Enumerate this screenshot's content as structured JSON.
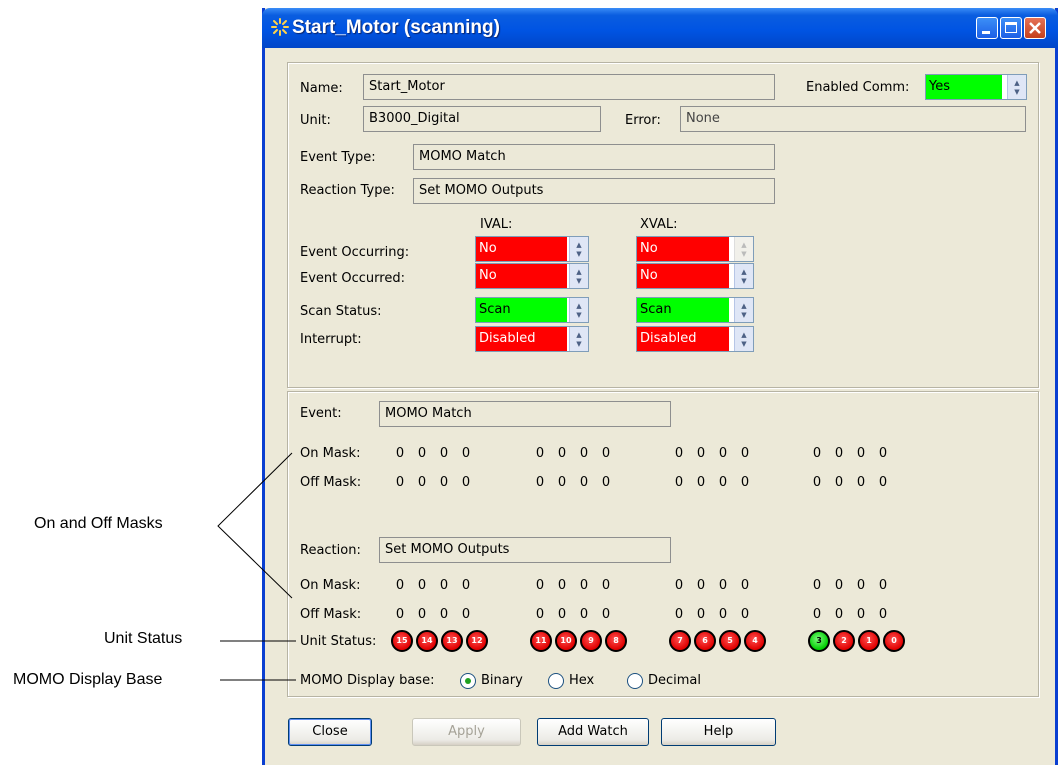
{
  "window": {
    "title": "Start_Motor (scanning)"
  },
  "fields": {
    "name_label": "Name:",
    "name_value": "Start_Motor",
    "enabled_comm_label": "Enabled Comm:",
    "enabled_comm_value": "Yes",
    "unit_label": "Unit:",
    "unit_value": "B3000_Digital",
    "error_label": "Error:",
    "error_value": "None",
    "event_type_label": "Event Type:",
    "event_type_value": "MOMO Match",
    "reaction_type_label": "Reaction Type:",
    "reaction_type_value": "Set MOMO Outputs"
  },
  "status_grid": {
    "ival_header": "IVAL:",
    "xval_header": "XVAL:",
    "rows": [
      {
        "label": "Event Occurring:",
        "ival": "No",
        "xval": "No"
      },
      {
        "label": "Event Occurred:",
        "ival": "No",
        "xval": "No"
      },
      {
        "label": "Scan Status:",
        "ival": "Scan",
        "xval": "Scan"
      },
      {
        "label": "Interrupt:",
        "ival": "Disabled",
        "xval": "Disabled"
      }
    ]
  },
  "event": {
    "label": "Event:",
    "value": "MOMO Match",
    "on_mask_label": "On Mask:",
    "on_mask": [
      "0",
      "0",
      "0",
      "0",
      "0",
      "0",
      "0",
      "0",
      "0",
      "0",
      "0",
      "0",
      "0",
      "0",
      "0",
      "0"
    ],
    "off_mask_label": "Off Mask:",
    "off_mask": [
      "0",
      "0",
      "0",
      "0",
      "0",
      "0",
      "0",
      "0",
      "0",
      "0",
      "0",
      "0",
      "0",
      "0",
      "0",
      "0"
    ]
  },
  "reaction": {
    "label": "Reaction:",
    "value": "Set MOMO Outputs",
    "on_mask_label": "On Mask:",
    "on_mask": [
      "0",
      "0",
      "0",
      "0",
      "0",
      "0",
      "0",
      "0",
      "0",
      "0",
      "0",
      "0",
      "0",
      "0",
      "0",
      "0"
    ],
    "off_mask_label": "Off Mask:",
    "off_mask": [
      "0",
      "0",
      "0",
      "0",
      "0",
      "0",
      "0",
      "0",
      "0",
      "0",
      "0",
      "0",
      "0",
      "0",
      "0",
      "0"
    ]
  },
  "unit_status": {
    "label": "Unit Status:",
    "leds": [
      {
        "n": "15",
        "state": "red"
      },
      {
        "n": "14",
        "state": "red"
      },
      {
        "n": "13",
        "state": "red"
      },
      {
        "n": "12",
        "state": "red"
      },
      {
        "n": "11",
        "state": "red"
      },
      {
        "n": "10",
        "state": "red"
      },
      {
        "n": "9",
        "state": "red"
      },
      {
        "n": "8",
        "state": "red"
      },
      {
        "n": "7",
        "state": "red"
      },
      {
        "n": "6",
        "state": "red"
      },
      {
        "n": "5",
        "state": "red"
      },
      {
        "n": "4",
        "state": "red"
      },
      {
        "n": "3",
        "state": "green"
      },
      {
        "n": "2",
        "state": "red"
      },
      {
        "n": "1",
        "state": "red"
      },
      {
        "n": "0",
        "state": "red"
      }
    ]
  },
  "display_base": {
    "label": "MOMO Display base:",
    "options": [
      "Binary",
      "Hex",
      "Decimal"
    ],
    "selected": "Binary"
  },
  "buttons": {
    "close": "Close",
    "apply": "Apply",
    "add_watch": "Add Watch",
    "help": "Help"
  },
  "callouts": {
    "masks": "On and Off Masks",
    "unit_status": "Unit Status",
    "display_base": "MOMO Display Base"
  },
  "colors": {
    "on": "#00ff00",
    "off": "#ff0000",
    "title_bar": "#0054e3"
  }
}
